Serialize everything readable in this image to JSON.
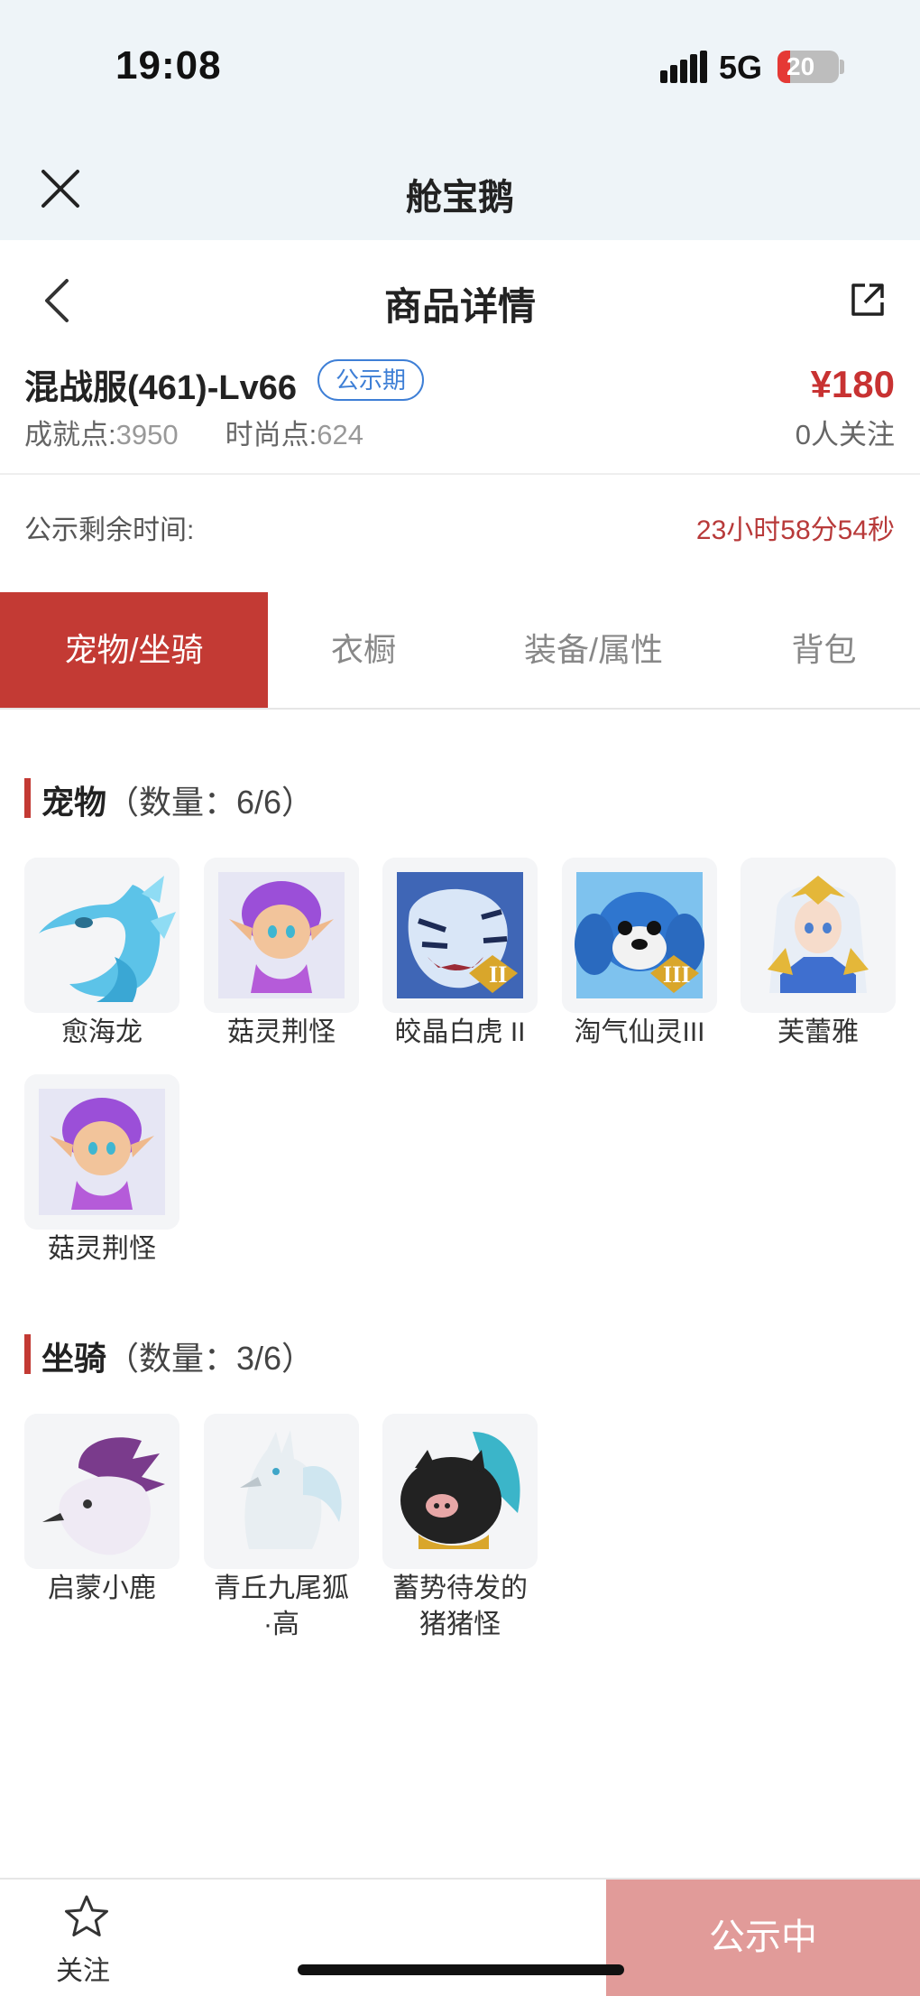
{
  "status": {
    "time": "19:08",
    "network": "5G",
    "battery": "20",
    "battery_level": 0.2
  },
  "app": {
    "title": "舱宝鹅"
  },
  "nav": {
    "title": "商品详情"
  },
  "item": {
    "name": "混战服(461)-Lv66",
    "badge": "公示期",
    "price": "¥180",
    "achievement_label": "成就点:",
    "achievement_value": "3950",
    "fashion_label": "时尚点:",
    "fashion_value": "624",
    "followers": "0人关注"
  },
  "remain": {
    "label": "公示剩余时间:",
    "value": "23小时58分54秒"
  },
  "tabs": [
    {
      "label": "宠物/坐骑",
      "active": true
    },
    {
      "label": "衣橱",
      "active": false
    },
    {
      "label": "装备/属性",
      "active": false
    },
    {
      "label": "背包",
      "active": false
    }
  ],
  "pets": {
    "title": "宠物",
    "count": "（数量：6/6）",
    "items": [
      {
        "name": "愈海龙",
        "rank": ""
      },
      {
        "name": "菇灵荆怪",
        "rank": ""
      },
      {
        "name": "皎晶白虎 II",
        "rank": "II"
      },
      {
        "name": "淘气仙灵III",
        "rank": "III"
      },
      {
        "name": "芙蕾雅",
        "rank": ""
      },
      {
        "name": "菇灵荆怪",
        "rank": ""
      }
    ]
  },
  "mounts": {
    "title": "坐骑",
    "count": "（数量：3/6）",
    "items": [
      {
        "name": "启蒙小鹿"
      },
      {
        "name_line1": "青丘九尾狐",
        "name_line2": "·高"
      },
      {
        "name_line1": "蓄势待发的",
        "name_line2": "猪猪怪"
      }
    ]
  },
  "footer": {
    "follow": "关注",
    "action": "公示中"
  },
  "colors": {
    "accent": "#c33a34",
    "price": "#c83232",
    "badge": "#3e7fd6",
    "action_disabled": "#e19b99"
  }
}
